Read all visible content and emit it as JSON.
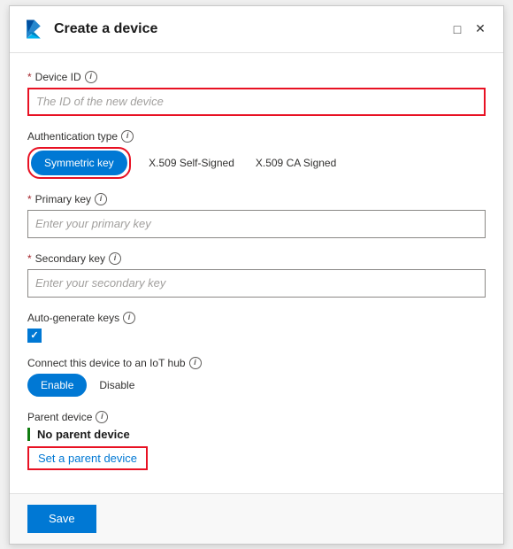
{
  "dialog": {
    "title": "Create a device",
    "icon_alt": "Azure IoT Hub icon"
  },
  "controls": {
    "minimize_symbol": "⬜",
    "close_symbol": "✕"
  },
  "form": {
    "device_id": {
      "label": "Device ID",
      "placeholder": "The ID of the new device",
      "value": ""
    },
    "auth_type": {
      "label": "Authentication type",
      "options": [
        "Symmetric key",
        "X.509 Self-Signed",
        "X.509 CA Signed"
      ],
      "selected": "Symmetric key"
    },
    "primary_key": {
      "label": "Primary key",
      "placeholder": "Enter your primary key",
      "value": ""
    },
    "secondary_key": {
      "label": "Secondary key",
      "placeholder": "Enter your secondary key",
      "value": ""
    },
    "auto_generate": {
      "label": "Auto-generate keys",
      "checked": true
    },
    "connect_to_hub": {
      "label": "Connect this device to an IoT hub",
      "options": [
        "Enable",
        "Disable"
      ],
      "selected": "Enable"
    },
    "parent_device": {
      "label": "Parent device",
      "value": "No parent device",
      "set_link": "Set a parent device"
    }
  },
  "footer": {
    "save_label": "Save"
  }
}
